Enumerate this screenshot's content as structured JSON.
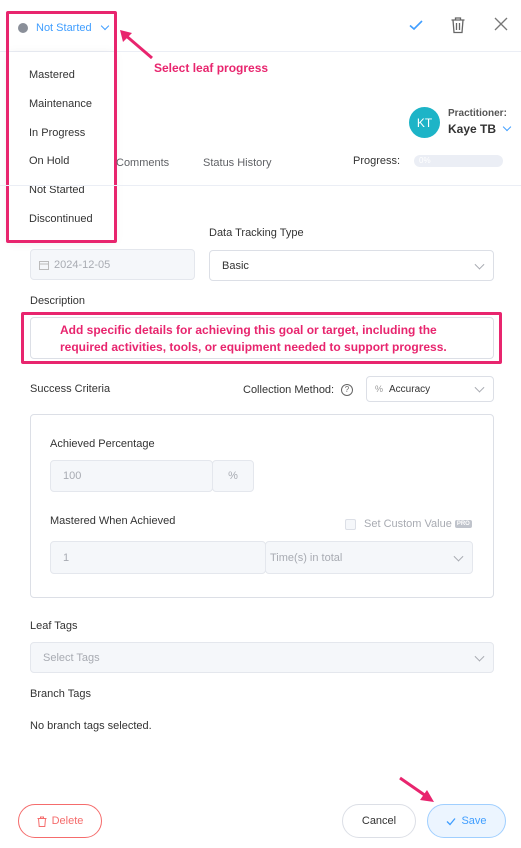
{
  "header": {
    "status_label": "Not Started",
    "status_menu": [
      "Mastered",
      "Maintenance",
      "In Progress",
      "On Hold",
      "Not Started",
      "Discontinued"
    ]
  },
  "annotations": {
    "select_leaf_progress": "Select leaf progress",
    "description_hint": "Add specific details for achieving this goal or target, including the required activities, tools, or equipment needed to support progress."
  },
  "practitioner": {
    "label": "Practitioner:",
    "initials": "KT",
    "name": "Kaye TB",
    "avatar_color": "#1db4c7"
  },
  "tabs": [
    "Comments",
    "Status History"
  ],
  "progress": {
    "label": "Progress:",
    "value_text": "0%",
    "value": 0
  },
  "date_field": {
    "value": "2024-12-05"
  },
  "data_tracking": {
    "label": "Data Tracking Type",
    "value": "Basic"
  },
  "description": {
    "label": "Description"
  },
  "success_criteria": {
    "label": "Success Criteria",
    "collection_method_label": "Collection Method:",
    "collection_method_value": "Accuracy",
    "achieved_percentage_label": "Achieved Percentage",
    "achieved_percentage_value": "100",
    "percent_unit": "%",
    "mastered_label": "Mastered When Achieved",
    "custom_value_label": "Set Custom Value",
    "pro_badge": "PRO",
    "mastered_value": "1",
    "mastered_unit": "Time(s) in total"
  },
  "leaf_tags": {
    "label": "Leaf Tags",
    "placeholder": "Select Tags"
  },
  "branch_tags": {
    "label": "Branch Tags",
    "empty_text": "No branch tags selected."
  },
  "footer": {
    "delete_label": "Delete",
    "cancel_label": "Cancel",
    "save_label": "Save"
  },
  "colors": {
    "accent": "#409eff",
    "annotation": "#e8256e",
    "danger": "#f56c6c"
  }
}
